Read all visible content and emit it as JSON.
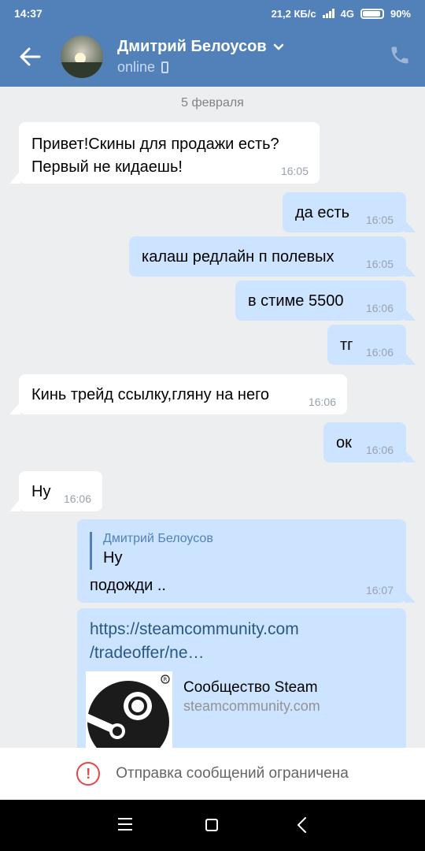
{
  "status_bar": {
    "time": "14:37",
    "speed": "21,2 КБ/с",
    "network": "4G",
    "battery": "90%"
  },
  "header": {
    "name": "Дмитрий Белоусов",
    "status": "online"
  },
  "chat": {
    "date": "5 февраля",
    "messages": [
      {
        "dir": "in",
        "text": "Привет!Скины для продажи есть?\nПервый не кидаешь!",
        "time": "16:05"
      },
      {
        "dir": "out",
        "text": "да есть",
        "time": "16:05"
      },
      {
        "dir": "out",
        "text": "калаш редлайн п полевых",
        "time": "16:05"
      },
      {
        "dir": "out",
        "text": "в стиме 5500",
        "time": "16:06"
      },
      {
        "dir": "out",
        "text": "тг",
        "time": "16:06"
      },
      {
        "dir": "in",
        "text": "Кинь трейд ссылку,гляну на него",
        "time": "16:06"
      },
      {
        "dir": "out",
        "text": "ок",
        "time": "16:06"
      },
      {
        "dir": "in",
        "text": "Ну",
        "time": "16:06"
      }
    ],
    "reply_message": {
      "quoted_name": "Дмитрий Белоусов",
      "quoted_text": "Ну",
      "text": "подожди ..",
      "time": "16:07"
    },
    "link_message": {
      "url": "https://steamcommunity.com\n/tradeoffer/ne…",
      "card_title": "Сообщество Steam",
      "card_url": "steamcommunity.com"
    }
  },
  "banner": {
    "text": "Отправка сообщений ограничена",
    "icon": "!"
  },
  "colors": {
    "accent": "#5181b8",
    "outgoing_bubble": "#cce4ff",
    "incoming_bubble": "#ffffff",
    "background": "#edeef0",
    "warning": "#e64646"
  }
}
